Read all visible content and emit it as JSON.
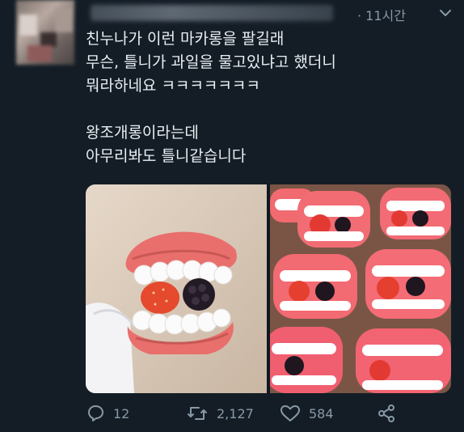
{
  "tweet": {
    "time": "· 11시간",
    "lines": [
      "친누나가 이런 마카롱을 팔길래",
      "무슨, 틀니가 과일을 물고있냐고 했더니",
      "뭐라하네요 ㅋㅋㅋㅋㅋㅋㅋ",
      "",
      "왕조개롱이라는데",
      "아무리봐도 틀니같습니다"
    ],
    "media": [
      {
        "icon": "macaron-hand-photo"
      },
      {
        "icon": "macaron-tray-photo"
      }
    ]
  },
  "actions": {
    "replies": "12",
    "retweets": "2,127",
    "likes": "584"
  },
  "colors": {
    "background": "#141d26",
    "text": "#e9eef2",
    "muted": "#8899a6"
  }
}
